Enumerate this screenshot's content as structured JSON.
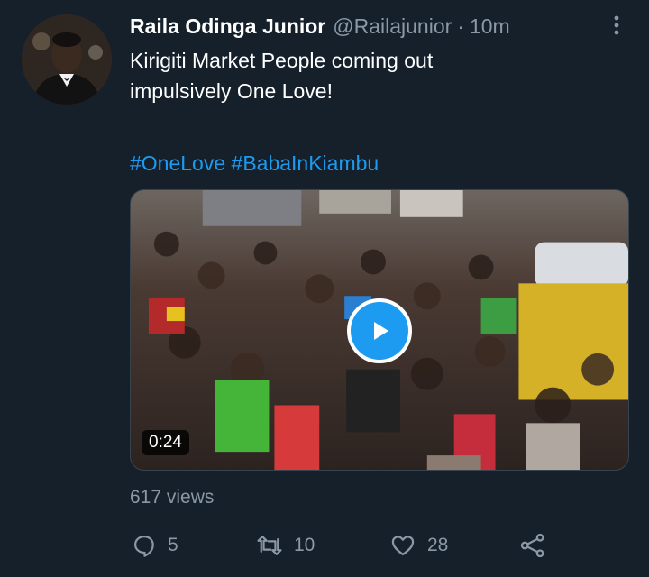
{
  "tweet": {
    "display_name": "Raila Odinga Junior",
    "handle": "@Railajunior",
    "separator": "·",
    "time": "10m",
    "text_lines": [
      "Kirigiti Market People coming out",
      "impulsively One Love!"
    ],
    "hashtags": [
      "#OneLove",
      "#BabaInKiambu"
    ],
    "media": {
      "type": "video",
      "duration": "0:24",
      "description_icon": "play-icon"
    },
    "views": "617 views",
    "actions": {
      "reply_count": "5",
      "retweet_count": "10",
      "like_count": "28"
    }
  },
  "icons": {
    "more": "more-vertical-icon",
    "reply": "reply-icon",
    "retweet": "retweet-icon",
    "like": "heart-icon",
    "share": "share-icon",
    "play": "play-icon"
  },
  "colors": {
    "background": "#15202b",
    "text_primary": "#ffffff",
    "text_secondary": "#8b98a5",
    "accent": "#1d9bf0"
  }
}
